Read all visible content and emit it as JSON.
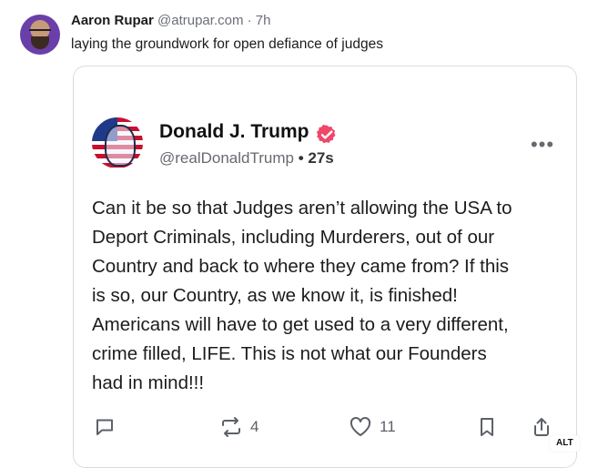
{
  "post": {
    "author_name": "Aaron Rupar",
    "author_handle": "@atrupar.com",
    "separator": "·",
    "time": "7h",
    "text": "laying the groundwork for open defiance of judges"
  },
  "embed": {
    "author_name": "Donald J. Trump",
    "handle": "@realDonaldTrump",
    "bullet": "•",
    "age": "27s",
    "more_label": "•••",
    "body_lines": [
      "Can it be so that Judges aren’t allowing the USA to",
      "Deport Criminals, including Murderers, out of our",
      "Country and back to where they came from? If this",
      "is so, our Country, as we know it, is finished!",
      "Americans will have to get used to a very different,",
      "crime filled, LIFE. This is not what our Founders",
      "had in mind!!!"
    ],
    "actions": {
      "reply_count": "",
      "repost_count": "4",
      "like_count": "11"
    },
    "colors": {
      "verified_badge": "#f0476b"
    }
  },
  "alt_badge": "ALT",
  "icons": [
    "avatar",
    "verified-check-icon",
    "more-options-icon",
    "reply-icon",
    "repost-icon",
    "like-icon",
    "bookmark-icon",
    "share-icon"
  ]
}
